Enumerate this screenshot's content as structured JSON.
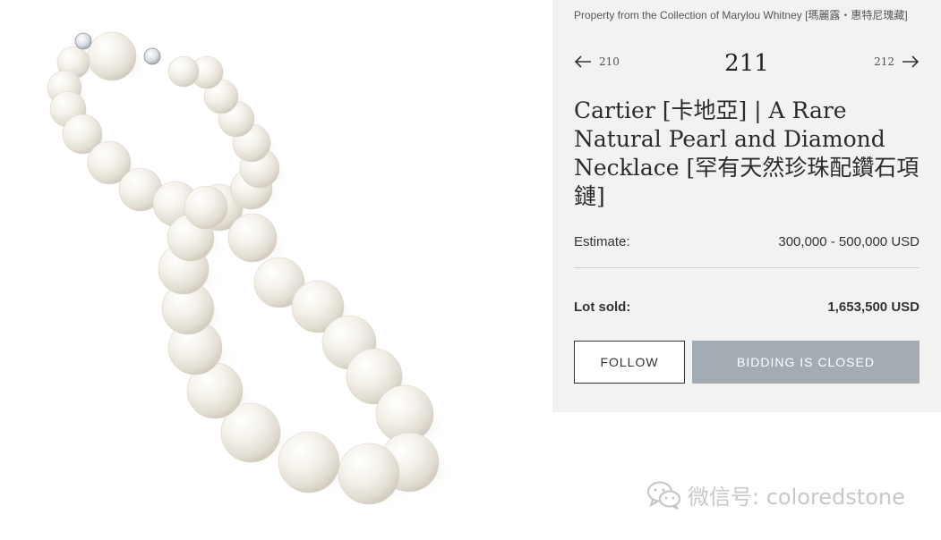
{
  "provenance": "Property from the Collection of Marylou Whitney [瑪麗露・惠特尼瑰藏]",
  "nav": {
    "prev_number": "210",
    "current_number": "211",
    "next_number": "212",
    "prev_icon": "arrow-left-icon",
    "next_icon": "arrow-right-icon"
  },
  "title": "Cartier [卡地亞] | A Rare Natural Pearl and Diamond Necklace [罕有天然珍珠配鑽石項鏈]",
  "estimate": {
    "label": "Estimate:",
    "value": "300,000 - 500,000 USD"
  },
  "sold": {
    "label": "Lot sold:",
    "value": "1,653,500 USD"
  },
  "buttons": {
    "follow": "FOLLOW",
    "bidding": "BIDDING IS CLOSED"
  },
  "watermark": {
    "text": "微信号: coloredstone",
    "icon": "wechat-icon"
  },
  "colors": {
    "panel_bg": "#f2f2f2",
    "bidding_bg": "#a3abb3",
    "pearl": "#f3efe6"
  }
}
